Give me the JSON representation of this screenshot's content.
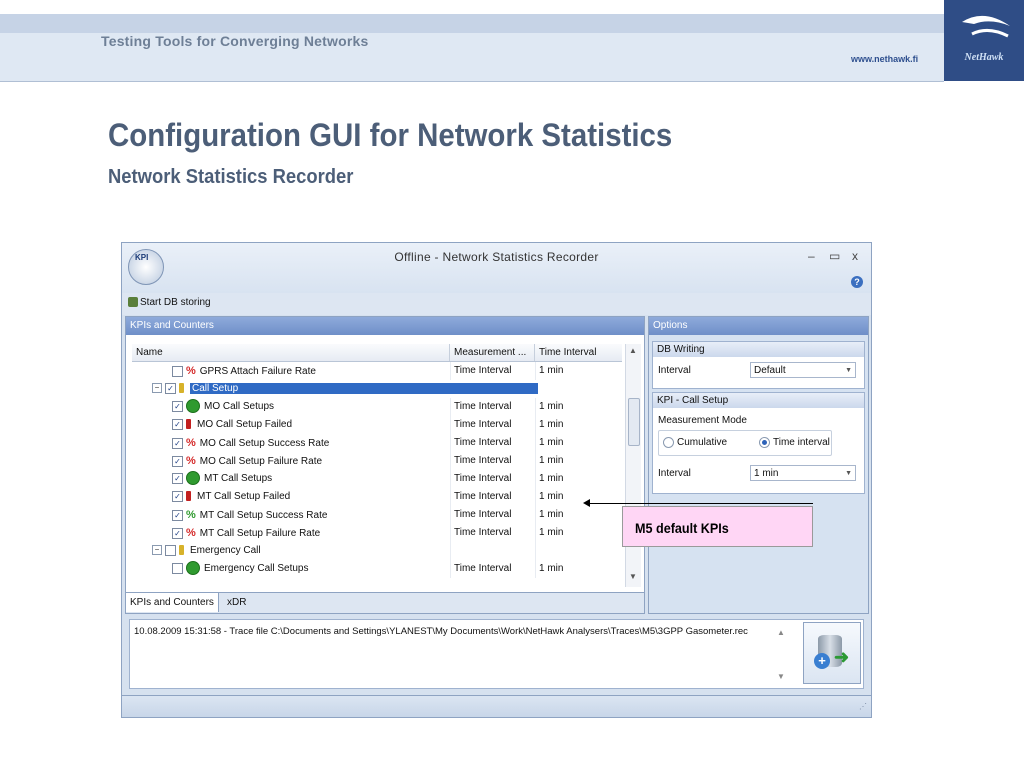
{
  "slide": {
    "tagline": "Testing Tools for Converging Networks",
    "url": "www.nethawk.fi",
    "logo_text": "NetHawk",
    "title": "Configuration GUI for Network Statistics",
    "subtitle": "Network Statistics Recorder"
  },
  "window": {
    "title": "Offline - Network Statistics Recorder",
    "app_icon_label": "KPI",
    "minimize": "–",
    "maximize": "▭",
    "close": "x",
    "help": "?",
    "toolbar_start": "Start DB storing"
  },
  "kpi_panel": {
    "header": "KPIs and Counters",
    "columns": [
      "Name",
      "Measurement ...",
      "Time Interval"
    ],
    "rows": [
      {
        "name": "GPRS Attach Failure Rate",
        "measurement": "Time Interval",
        "interval": "1 min",
        "icon": "percent-icon"
      },
      {
        "name": "Call Setup",
        "measurement": "",
        "interval": "",
        "icon": "phone-yellow-icon"
      },
      {
        "name": "MO Call Setups",
        "measurement": "Time Interval",
        "interval": "1 min",
        "icon": "green-phone-icon"
      },
      {
        "name": "MO Call Setup Failed",
        "measurement": "Time Interval",
        "interval": "1 min",
        "icon": "red-phone-icon"
      },
      {
        "name": "MO Call Setup Success Rate",
        "measurement": "Time Interval",
        "interval": "1 min",
        "icon": "percent-icon"
      },
      {
        "name": "MO Call Setup Failure Rate",
        "measurement": "Time Interval",
        "interval": "1 min",
        "icon": "percent-icon"
      },
      {
        "name": "MT Call Setups",
        "measurement": "Time Interval",
        "interval": "1 min",
        "icon": "green-phone-icon"
      },
      {
        "name": "MT Call Setup Failed",
        "measurement": "Time Interval",
        "interval": "1 min",
        "icon": "red-phone-icon"
      },
      {
        "name": "MT Call Setup Success Rate",
        "measurement": "Time Interval",
        "interval": "1 min",
        "icon": "percent-icon"
      },
      {
        "name": "MT Call Setup Failure Rate",
        "measurement": "Time Interval",
        "interval": "1 min",
        "icon": "percent-icon"
      },
      {
        "name": "Emergency Call",
        "measurement": "",
        "interval": "",
        "icon": "phone-yellow-icon"
      },
      {
        "name": "Emergency Call Setups",
        "measurement": "Time Interval",
        "interval": "1 min",
        "icon": "green-phone-icon"
      }
    ],
    "tabs": [
      "KPIs and Counters",
      "xDR"
    ]
  },
  "options_panel": {
    "header": "Options",
    "db_writing": {
      "header": "DB Writing",
      "interval_label": "Interval",
      "interval_value": "Default"
    },
    "kpi_call_setup": {
      "header": "KPI - Call Setup",
      "mode_label": "Measurement Mode",
      "cumulative": "Cumulative",
      "time_interval": "Time interval",
      "interval_label": "Interval",
      "interval_value": "1 min"
    }
  },
  "log": {
    "text": "10.08.2009 15:31:58 - Trace file C:\\Documents and Settings\\YLANEST\\My Documents\\Work\\NetHawk Analysers\\Traces\\M5\\3GPP Gasometer.rec"
  },
  "callout": {
    "text": "M5 default KPIs"
  },
  "colors": {
    "selection": "#2f6ac4",
    "callout_bg": "#ffd6f5",
    "title": "#4c5e78"
  }
}
